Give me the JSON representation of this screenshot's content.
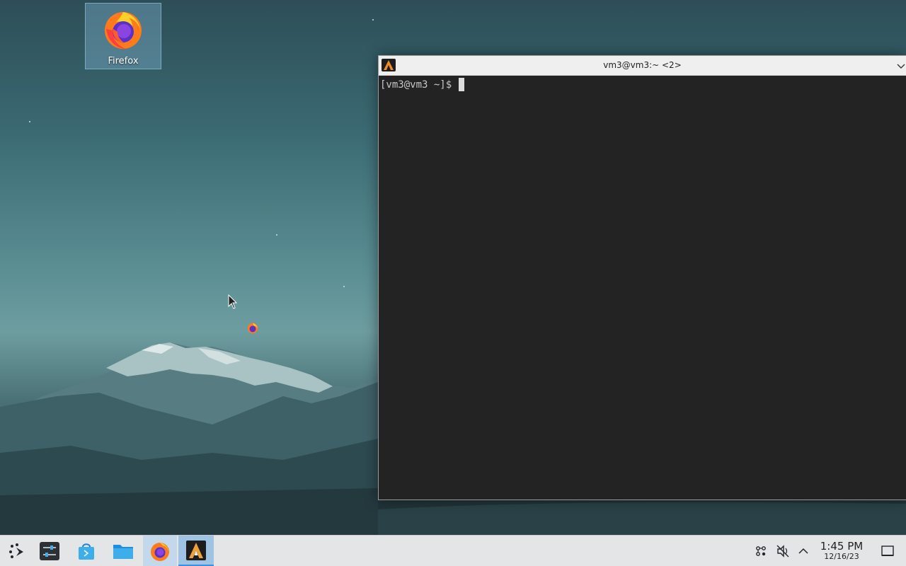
{
  "desktop": {
    "icons": [
      {
        "label": "Firefox",
        "icon": "firefox-icon"
      }
    ],
    "dragging_icon": "firefox-icon"
  },
  "terminal": {
    "title": "vm3@vm3:~ <2>",
    "prompt": "[vm3@vm3 ~]$",
    "app_icon": "alacritty-icon"
  },
  "taskbar": {
    "launcher_icon": "application-launcher-icon",
    "items": [
      {
        "name": "system-settings",
        "icon": "settings-sliders-icon"
      },
      {
        "name": "discover",
        "icon": "store-bag-icon"
      },
      {
        "name": "file-manager",
        "icon": "folder-icon"
      },
      {
        "name": "firefox",
        "icon": "firefox-icon",
        "active": true
      },
      {
        "name": "alacritty",
        "icon": "alacritty-icon",
        "active": true
      }
    ],
    "tray": [
      {
        "name": "network",
        "icon": "network-icon"
      },
      {
        "name": "volume",
        "icon": "volume-muted-icon"
      },
      {
        "name": "tray-expand",
        "icon": "chevron-up-icon"
      }
    ],
    "clock": {
      "time": "1:45 PM",
      "date": "12/16/23"
    },
    "show_desktop_icon": "show-desktop-icon"
  },
  "colors": {
    "terminal_bg": "#232323",
    "taskbar_bg": "#e4e5e7",
    "active_task": "#9fc3e2"
  }
}
